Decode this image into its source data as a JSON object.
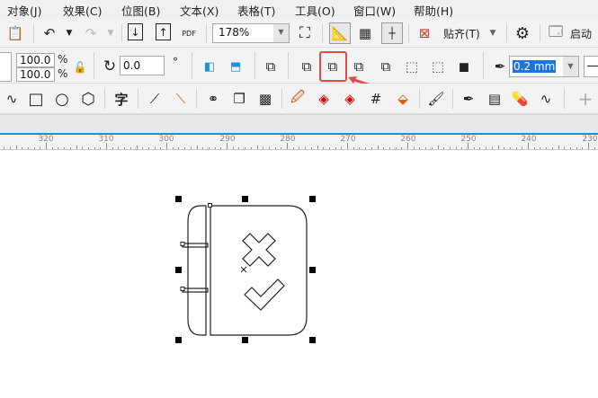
{
  "menu": [
    "对象(J)",
    "效果(C)",
    "位图(B)",
    "文本(X)",
    "表格(T)",
    "工具(O)",
    "窗口(W)",
    "帮助(H)"
  ],
  "toolbar1": {
    "zoom": "178%",
    "snap": "贴齐(T)",
    "launch": "启动",
    "pdf": "PDF"
  },
  "toolbar2": {
    "scale_w": "100.0",
    "scale_h": "100.0",
    "pct": "%",
    "rotation": "0.0",
    "degree": "°",
    "outline_width": "0.2 mm"
  },
  "toolbar3": {
    "text_tool": "字",
    "add": "+"
  },
  "ruler": [
    "320",
    "310",
    "300",
    "290",
    "280",
    "270",
    "260",
    "250",
    "240",
    "230"
  ],
  "accent": "#1e90d8",
  "highlight": "#e84848"
}
